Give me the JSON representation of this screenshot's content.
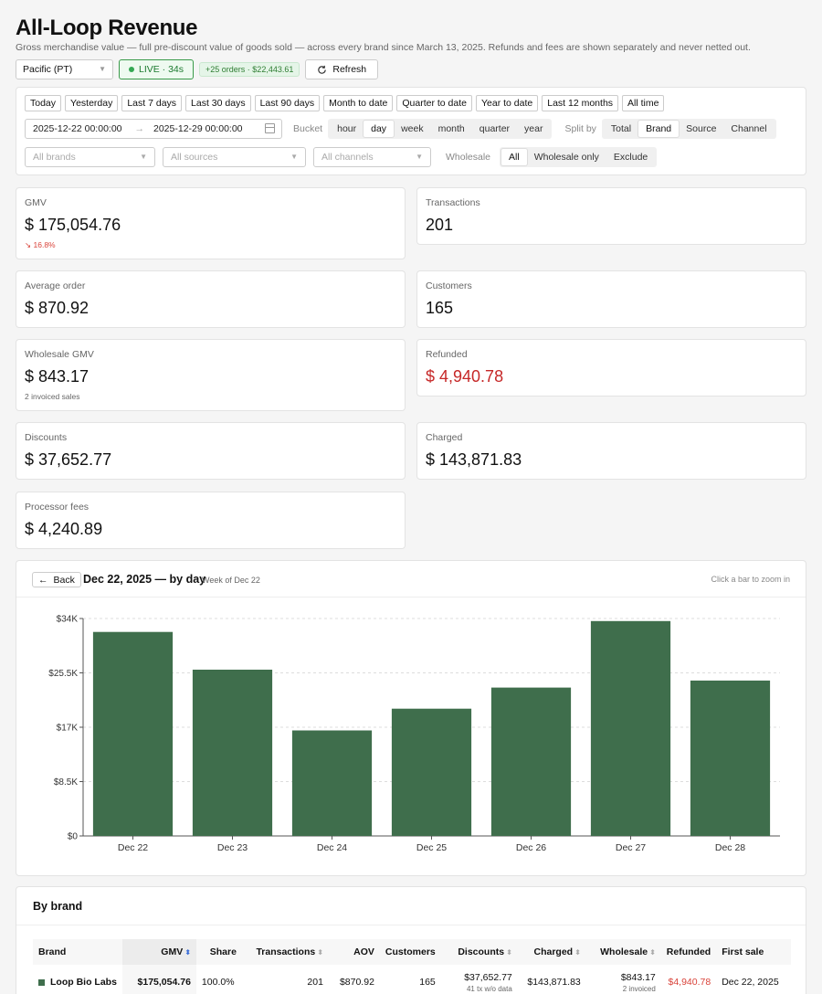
{
  "header": {
    "title": "All-Loop Revenue",
    "subtitle": "Gross merchandise value — full pre-discount value of goods sold — across every brand since March 13, 2025. Refunds and fees are shown separately and never netted out.",
    "timezone": "Pacific (PT)",
    "live": "LIVE · 34s",
    "orders_badge": "+25 orders · $22,443.61",
    "refresh": "Refresh"
  },
  "filters": {
    "presets": [
      "Today",
      "Yesterday",
      "Last 7 days",
      "Last 30 days",
      "Last 90 days",
      "Month to date",
      "Quarter to date",
      "Year to date",
      "Last 12 months",
      "All time"
    ],
    "date_from": "2025-12-22 00:00:00",
    "date_to": "2025-12-29 00:00:00",
    "bucket_label": "Bucket",
    "buckets": [
      "hour",
      "day",
      "week",
      "month",
      "quarter",
      "year"
    ],
    "bucket_selected": "day",
    "split_label": "Split by",
    "splits": [
      "Total",
      "Brand",
      "Source",
      "Channel"
    ],
    "split_selected": "Brand",
    "brands_placeholder": "All brands",
    "sources_placeholder": "All sources",
    "channels_placeholder": "All channels",
    "wholesale_label": "Wholesale",
    "wholesale_opts": [
      "All",
      "Wholesale only",
      "Exclude"
    ],
    "wholesale_selected": "All"
  },
  "kpis": {
    "gmv": {
      "label": "GMV",
      "value": "$ 175,054.76",
      "delta": "16.8%"
    },
    "transactions": {
      "label": "Transactions",
      "value": "201"
    },
    "avg_order": {
      "label": "Average order",
      "value": "$ 870.92"
    },
    "customers": {
      "label": "Customers",
      "value": "165"
    },
    "wholesale_gmv": {
      "label": "Wholesale GMV",
      "value": "$ 843.17",
      "sub": "2 invoiced sales"
    },
    "refunded": {
      "label": "Refunded",
      "value": "$ 4,940.78"
    },
    "discounts": {
      "label": "Discounts",
      "value": "$ 37,652.77"
    },
    "charged": {
      "label": "Charged",
      "value": "$ 143,871.83"
    },
    "fees": {
      "label": "Processor fees",
      "value": "$ 4,240.89"
    }
  },
  "chart": {
    "back": "Back",
    "title": "Dec 22, 2025 — by day",
    "week": "Week of Dec 22",
    "hint": "Click a bar to zoom in",
    "bar_color": "#3f6e4c"
  },
  "chart_data": {
    "type": "bar",
    "categories": [
      "Dec 22",
      "Dec 23",
      "Dec 24",
      "Dec 25",
      "Dec 26",
      "Dec 27",
      "Dec 28"
    ],
    "values": [
      31900,
      26000,
      16500,
      19900,
      23200,
      33600,
      24300
    ],
    "yticks": [
      "$0",
      "$8.5K",
      "$17K",
      "$25.5K",
      "$34K"
    ],
    "ylim": [
      0,
      34000
    ],
    "grid": true
  },
  "brands": {
    "title": "By brand",
    "columns": [
      "Brand",
      "GMV",
      "Share",
      "Transactions",
      "AOV",
      "Customers",
      "Discounts",
      "Charged",
      "Wholesale",
      "Refunded",
      "First sale"
    ],
    "rows": [
      {
        "brand": "Loop Bio Labs",
        "gmv": "$175,054.76",
        "share": "100.0%",
        "transactions": "201",
        "aov": "$870.92",
        "customers": "165",
        "discounts": "$37,652.77",
        "discounts_note": "41 tx w/o data",
        "charged": "$143,871.83",
        "wholesale": "$843.17",
        "wholesale_note": "2 invoiced",
        "refunded": "$4,940.78",
        "first_sale": "Dec 22, 2025"
      }
    ]
  }
}
